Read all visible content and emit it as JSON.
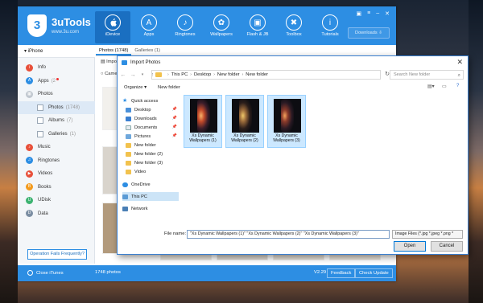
{
  "app": {
    "brand": "3uTools",
    "url": "www.3u.com",
    "nav": [
      {
        "label": "iDevice",
        "icon": "apple-icon",
        "glyph": ""
      },
      {
        "label": "Apps",
        "icon": "apps-icon",
        "glyph": "A"
      },
      {
        "label": "Ringtones",
        "icon": "bell-icon",
        "glyph": "♪"
      },
      {
        "label": "Wallpapers",
        "icon": "wallpaper-icon",
        "glyph": "✿"
      },
      {
        "label": "Flash & JB",
        "icon": "box-icon",
        "glyph": "▣"
      },
      {
        "label": "Toolbox",
        "icon": "toolbox-icon",
        "glyph": "✖"
      },
      {
        "label": "Tutorials",
        "icon": "info-icon",
        "glyph": "i"
      }
    ],
    "downloads": "Downloads ⇩"
  },
  "sidebar": {
    "device": "iPhone",
    "items": [
      {
        "label": "Info",
        "color": "#e8503a",
        "count": ""
      },
      {
        "label": "Apps",
        "color": "#2d8ee3",
        "count": "(2"
      },
      {
        "label": "Photos",
        "color": "#c0c7cf",
        "count": ""
      },
      {
        "label": "Photos",
        "count": "(1748)"
      },
      {
        "label": "Albums",
        "count": "(7)"
      },
      {
        "label": "Galleries",
        "count": "(1)"
      },
      {
        "label": "Music",
        "color": "#e8503a",
        "count": ""
      },
      {
        "label": "Ringtones",
        "color": "#2d8ee3",
        "count": ""
      },
      {
        "label": "Videos",
        "color": "#e8503a",
        "count": ""
      },
      {
        "label": "Books",
        "color": "#f39a1c",
        "count": ""
      },
      {
        "label": "UDisk",
        "color": "#3cb371",
        "count": ""
      },
      {
        "label": "Data",
        "color": "#7b8ea3",
        "count": ""
      }
    ],
    "operation_fails": "Operation Fails Frequently?"
  },
  "content": {
    "tabs": [
      "Photos (1748)",
      "Galleries (1)"
    ],
    "toolbar_import": "Impo",
    "toolbar_camera": "Came"
  },
  "status": {
    "close_itunes": "Close iTunes",
    "photos": "1748 photos",
    "version": "V2.29",
    "feedback": "Feedback",
    "check_update": "Check Update"
  },
  "dialog": {
    "title": "Import Photos",
    "path": [
      "This PC",
      "Desktop",
      "New folder",
      "New folder"
    ],
    "search_placeholder": "Search New folder",
    "organize": "Organize ▾",
    "new_folder": "New folder",
    "nav_items": [
      {
        "label": "Quick access",
        "kind": "star",
        "pinned": false
      },
      {
        "label": "Desktop",
        "kind": "folder-blue",
        "pinned": true
      },
      {
        "label": "Downloads",
        "kind": "download",
        "pinned": true
      },
      {
        "label": "Documents",
        "kind": "doc",
        "pinned": true
      },
      {
        "label": "Pictures",
        "kind": "pic",
        "pinned": true
      },
      {
        "label": "New folder",
        "kind": "folder",
        "pinned": false
      },
      {
        "label": "New folder (2)",
        "kind": "folder",
        "pinned": false
      },
      {
        "label": "New folder (3)",
        "kind": "folder",
        "pinned": false
      },
      {
        "label": "Video",
        "kind": "folder",
        "pinned": false
      },
      {
        "label": "OneDrive",
        "kind": "cloud",
        "pinned": false
      },
      {
        "label": "This PC",
        "kind": "pc",
        "pinned": false
      },
      {
        "label": "Network",
        "kind": "network",
        "pinned": false
      }
    ],
    "files": [
      {
        "label1": "Xs Dynamic",
        "label2": "Wallpapers (1)"
      },
      {
        "label1": "Xs Dynamic",
        "label2": "Wallpapers (2)"
      },
      {
        "label1": "Xs Dynamic",
        "label2": "Wallpapers (3)"
      }
    ],
    "file_name_label": "File name:",
    "file_name_value": "\"Xs Dynamic Wallpapers (1)\" \"Xs Dynamic Wallpapers (2)\" \"Xs Dynamic Wallpapers (3)\"",
    "file_type": "Image Files (*.jpg *.jpeg *.png *",
    "open": "Open",
    "cancel": "Cancel"
  }
}
